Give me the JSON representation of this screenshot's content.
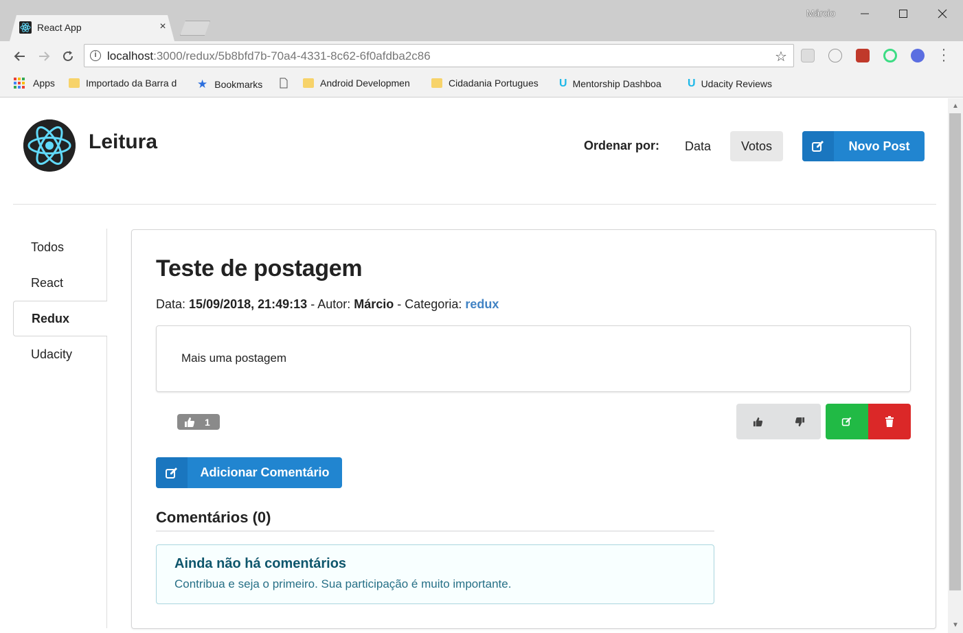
{
  "browser": {
    "tab_title": "React App",
    "tab_close": "×",
    "profile_name": "Márcio",
    "url_host": "localhost",
    "url_rest": ":3000/redux/5b8bfd7b-70a4-4331-8c62-6f0afdba2c86",
    "bookmarks": {
      "apps": "Apps",
      "item1": "Importado da Barra d",
      "item2": "Bookmarks",
      "item3": "Android Developmen",
      "item4": "Cidadania Portugues",
      "item5": "Mentorship Dashboa",
      "item6": "Udacity Reviews"
    }
  },
  "header": {
    "brand": "Leitura",
    "order_label": "Ordenar por:",
    "sort_date": "Data",
    "sort_votes": "Votos",
    "new_post": "Novo Post"
  },
  "sidebar": {
    "items": [
      {
        "label": "Todos"
      },
      {
        "label": "React"
      },
      {
        "label": "Redux"
      },
      {
        "label": "Udacity"
      }
    ]
  },
  "post": {
    "title": "Teste de postagem",
    "date_label": "Data:",
    "date": "15/09/2018, 21:49:13",
    "author_label": " - Autor:",
    "author": "Márcio",
    "category_label": " - Categoria:",
    "category": "redux",
    "body": "Mais uma postagem",
    "vote_score": "1",
    "add_comment": "Adicionar Comentário"
  },
  "comments": {
    "title": "Comentários (0)",
    "empty_title": "Ainda não há comentários",
    "empty_text": "Contribua e seja o primeiro. Sua participação é muito importante."
  },
  "colors": {
    "primary": "#2185d0",
    "success": "#21ba45",
    "danger": "#db2828",
    "info_bg": "#f8ffff",
    "react_cyan": "#61dafb"
  }
}
